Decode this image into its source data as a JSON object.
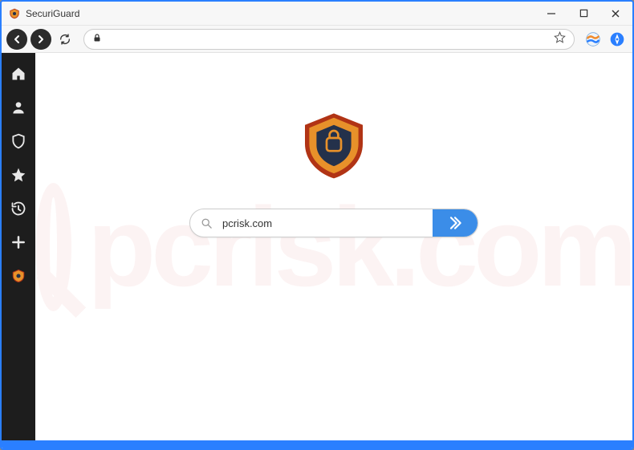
{
  "titlebar": {
    "title": "SecuriGuard"
  },
  "navbar": {
    "url_value": "",
    "url_placeholder": ""
  },
  "sidebar": {
    "items": [
      {
        "name": "home"
      },
      {
        "name": "user"
      },
      {
        "name": "shield"
      },
      {
        "name": "star"
      },
      {
        "name": "history"
      },
      {
        "name": "plus"
      },
      {
        "name": "shield-badge"
      }
    ]
  },
  "search": {
    "value": "pcrisk.com",
    "placeholder": ""
  },
  "watermark": {
    "text": "pcrisk.com"
  },
  "colors": {
    "accent": "#2a7fff",
    "sidebar_bg": "#1d1d1d",
    "search_button": "#3b8de8",
    "shield_outer": "#b13415",
    "shield_inner": "#e8912a",
    "shield_core": "#24314b"
  }
}
